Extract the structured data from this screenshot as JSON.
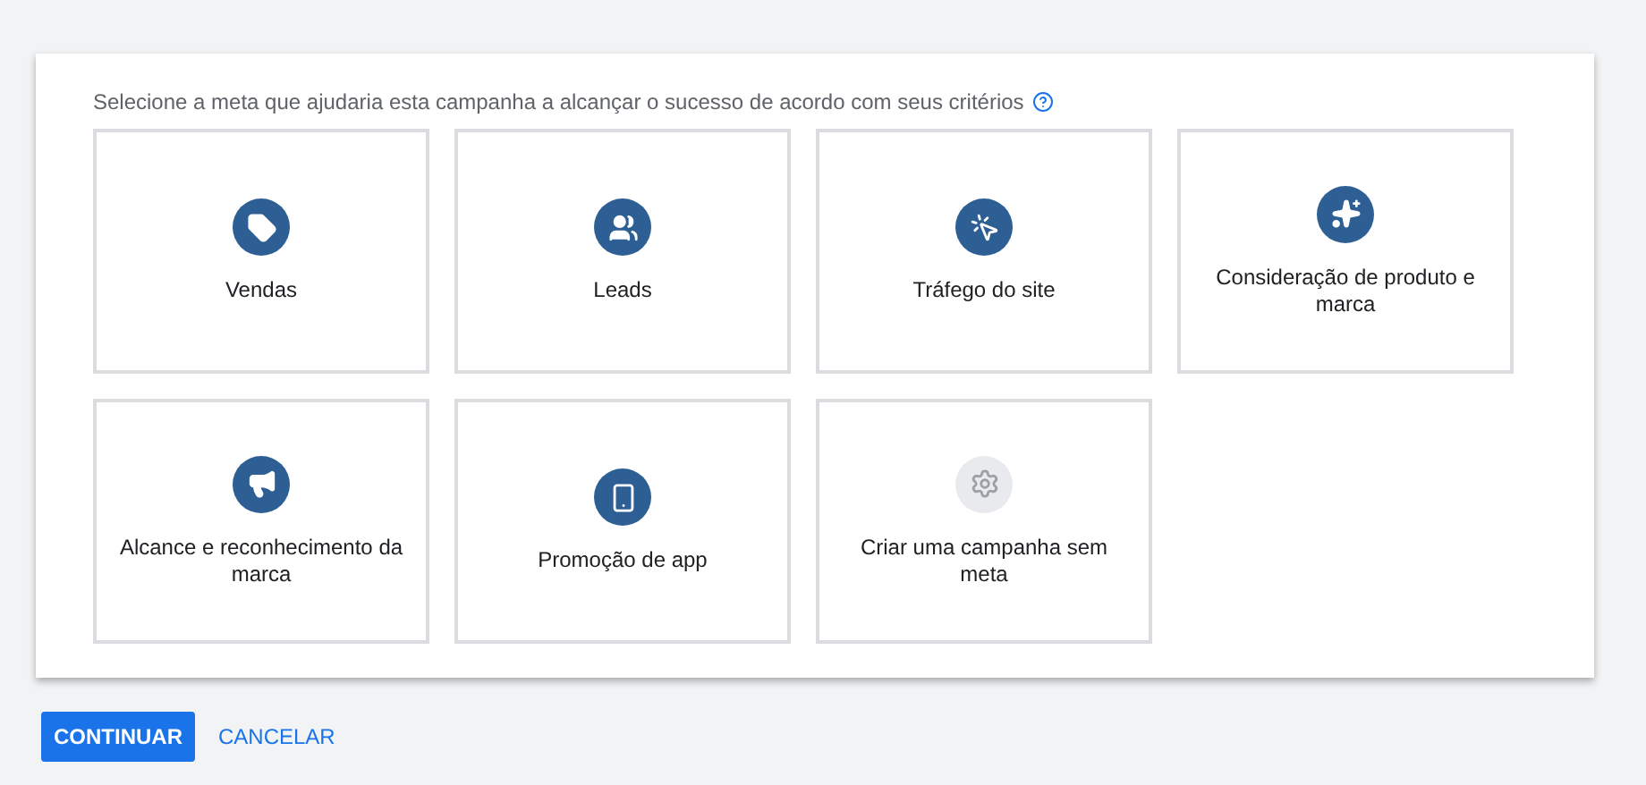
{
  "prompt": "Selecione a meta que ajudaria esta campanha a alcançar o sucesso de acordo com seus critérios",
  "goals": [
    {
      "kind": "tag",
      "label": "Vendas"
    },
    {
      "kind": "people",
      "label": "Leads"
    },
    {
      "kind": "click",
      "label": "Tráfego do site"
    },
    {
      "kind": "sparkle",
      "label": "Consideração de produto e marca"
    },
    {
      "kind": "megaphone",
      "label": "Alcance e reconhecimento da marca"
    },
    {
      "kind": "phone",
      "label": "Promoção de app"
    },
    {
      "kind": "gear",
      "label": "Criar uma campanha sem meta"
    }
  ],
  "buttons": [
    {
      "kind": "primary",
      "label": "CONTINUAR"
    },
    {
      "kind": "text",
      "label": "CANCELAR"
    }
  ]
}
